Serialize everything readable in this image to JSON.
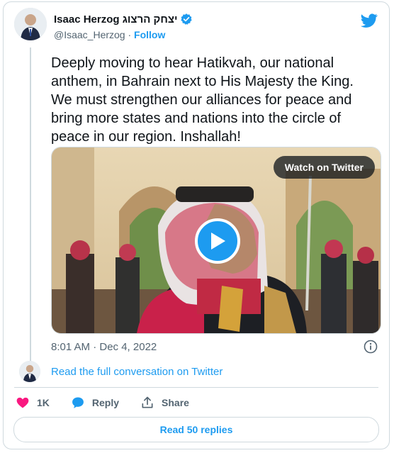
{
  "author": {
    "display_name": "Isaac Herzog יצחק הרצוג",
    "handle": "@Isaac_Herzog",
    "separator": "·",
    "follow_label": "Follow"
  },
  "tweet": {
    "text": "Deeply moving to hear Hatikvah, our national anthem, in Bahrain next to His Majesty the King. We must strengthen our alliances for peace and bring more states and nations into the circle of peace in our region. Inshallah!",
    "timestamp": "8:01 AM · Dec 4, 2022"
  },
  "media": {
    "watch_label": "Watch on Twitter"
  },
  "conversation": {
    "read_full_label": "Read the full conversation on Twitter"
  },
  "actions": {
    "like_count": "1K",
    "reply_label": "Reply",
    "share_label": "Share",
    "read_replies_label": "Read 50 replies"
  },
  "colors": {
    "accent": "#1d9bf0",
    "like": "#f91880",
    "muted": "#536471",
    "border": "#cfd9de"
  }
}
